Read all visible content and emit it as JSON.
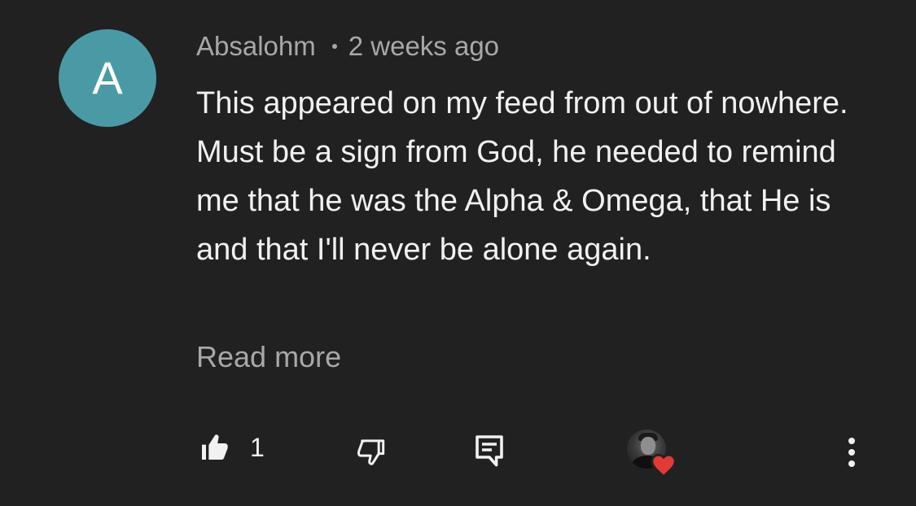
{
  "comment": {
    "author_initial": "A",
    "author": "Absalohm",
    "time": "2 weeks ago",
    "text": "This appeared on my feed from out of nowhere. Must be a sign from God, he needed to remind me that he was the Alpha & Omega, that He is and that I'll never be alone again.",
    "read_more_label": "Read more",
    "like_count": "1",
    "avatar_color": "#4a9aa6",
    "heart_color": "#e53935"
  },
  "icons": {
    "like": "thumbs-up-filled-icon",
    "dislike": "thumbs-down-outline-icon",
    "reply": "reply-comment-icon",
    "heart": "heart-icon",
    "more": "more-vertical-icon"
  }
}
